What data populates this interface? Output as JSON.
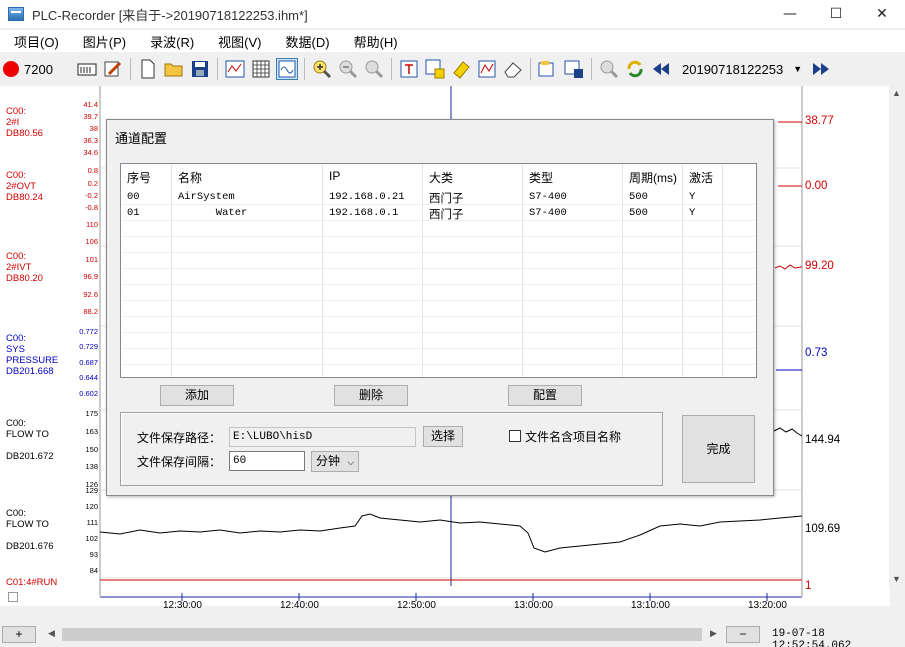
{
  "window": {
    "title": "PLC-Recorder  [来自于->20190718122253.ihm*]",
    "minimize": "—",
    "maximize": "☐",
    "close": "✕"
  },
  "menu": [
    "项目(O)",
    "图片(P)",
    "录波(R)",
    "视图(V)",
    "数据(D)",
    "帮助(H)"
  ],
  "toolbar": {
    "record_count": "7200",
    "file_selector": "20190718122253"
  },
  "channels": [
    {
      "lines": [
        "C00:",
        "2#I",
        "DB80.56"
      ],
      "color": "#d00000",
      "value": "38.77",
      "ticks": [
        "41.4",
        "39.7",
        "38",
        "36.3",
        "34.6"
      ]
    },
    {
      "lines": [
        "C00:",
        "2#OVT",
        "DB80.24"
      ],
      "color": "#d00000",
      "value": "0.00",
      "ticks": [
        "0.8",
        "0.2",
        "-0.2",
        "-0.8",
        "110"
      ]
    },
    {
      "lines": [
        "C00:",
        "2#IVT",
        "DB80.20"
      ],
      "color": "#d00000",
      "value": "99.20",
      "ticks": [
        "106",
        "101",
        "96.9",
        "92.6",
        "88.2"
      ]
    },
    {
      "lines": [
        "C00:",
        "SYS",
        "PRESSURE",
        "DB201.668"
      ],
      "color": "#0000c0",
      "value": "0.73",
      "ticks": [
        "0.772",
        "0.729",
        "0.687",
        "0.644",
        "0.602"
      ]
    },
    {
      "lines": [
        "C00:",
        "FLOW TO",
        "",
        "DB201.672"
      ],
      "color": "#000000",
      "value": "144.94",
      "ticks": [
        "175",
        "163",
        "150",
        "138",
        "126"
      ]
    },
    {
      "lines": [
        "C00:",
        "FLOW TO",
        "",
        "DB201.676"
      ],
      "color": "#000000",
      "value": "109.69",
      "ticks": [
        "129",
        "120",
        "111",
        "102",
        "93",
        "84"
      ]
    },
    {
      "lines": [
        "C01:4#RUN"
      ],
      "color": "#d00000",
      "value": "1",
      "ticks": []
    }
  ],
  "time_axis": [
    "12:30:00",
    "12:40:00",
    "12:50:00",
    "13:00:00",
    "13:10:00",
    "13:20:00"
  ],
  "bottom": {
    "plus": "+",
    "minus": "−",
    "timestamp": "19-07-18 12:52:54.062"
  },
  "dialog": {
    "title": "通道配置",
    "columns": [
      "序号",
      "名称",
      "IP",
      "大类",
      "类型",
      "周期(ms)",
      "激活"
    ],
    "rows": [
      [
        "00",
        "AirSystem",
        "192.168.0.21",
        "西门子",
        "S7-400",
        "500",
        "Y"
      ],
      [
        "01",
        "      Water",
        "192.168.0.1",
        "西门子",
        "S7-400",
        "500",
        "Y"
      ]
    ],
    "add_button": "添加",
    "delete_button": "删除",
    "config_button": "配置",
    "path_label": "文件保存路径：",
    "path_value": "E:\\LUBO\\hisD",
    "select_button": "选择",
    "include_name_label": "文件名含项目名称",
    "interval_label": "文件保存间隔：",
    "interval_value": "60",
    "unit_value": "分钟",
    "done_button": "完成"
  }
}
